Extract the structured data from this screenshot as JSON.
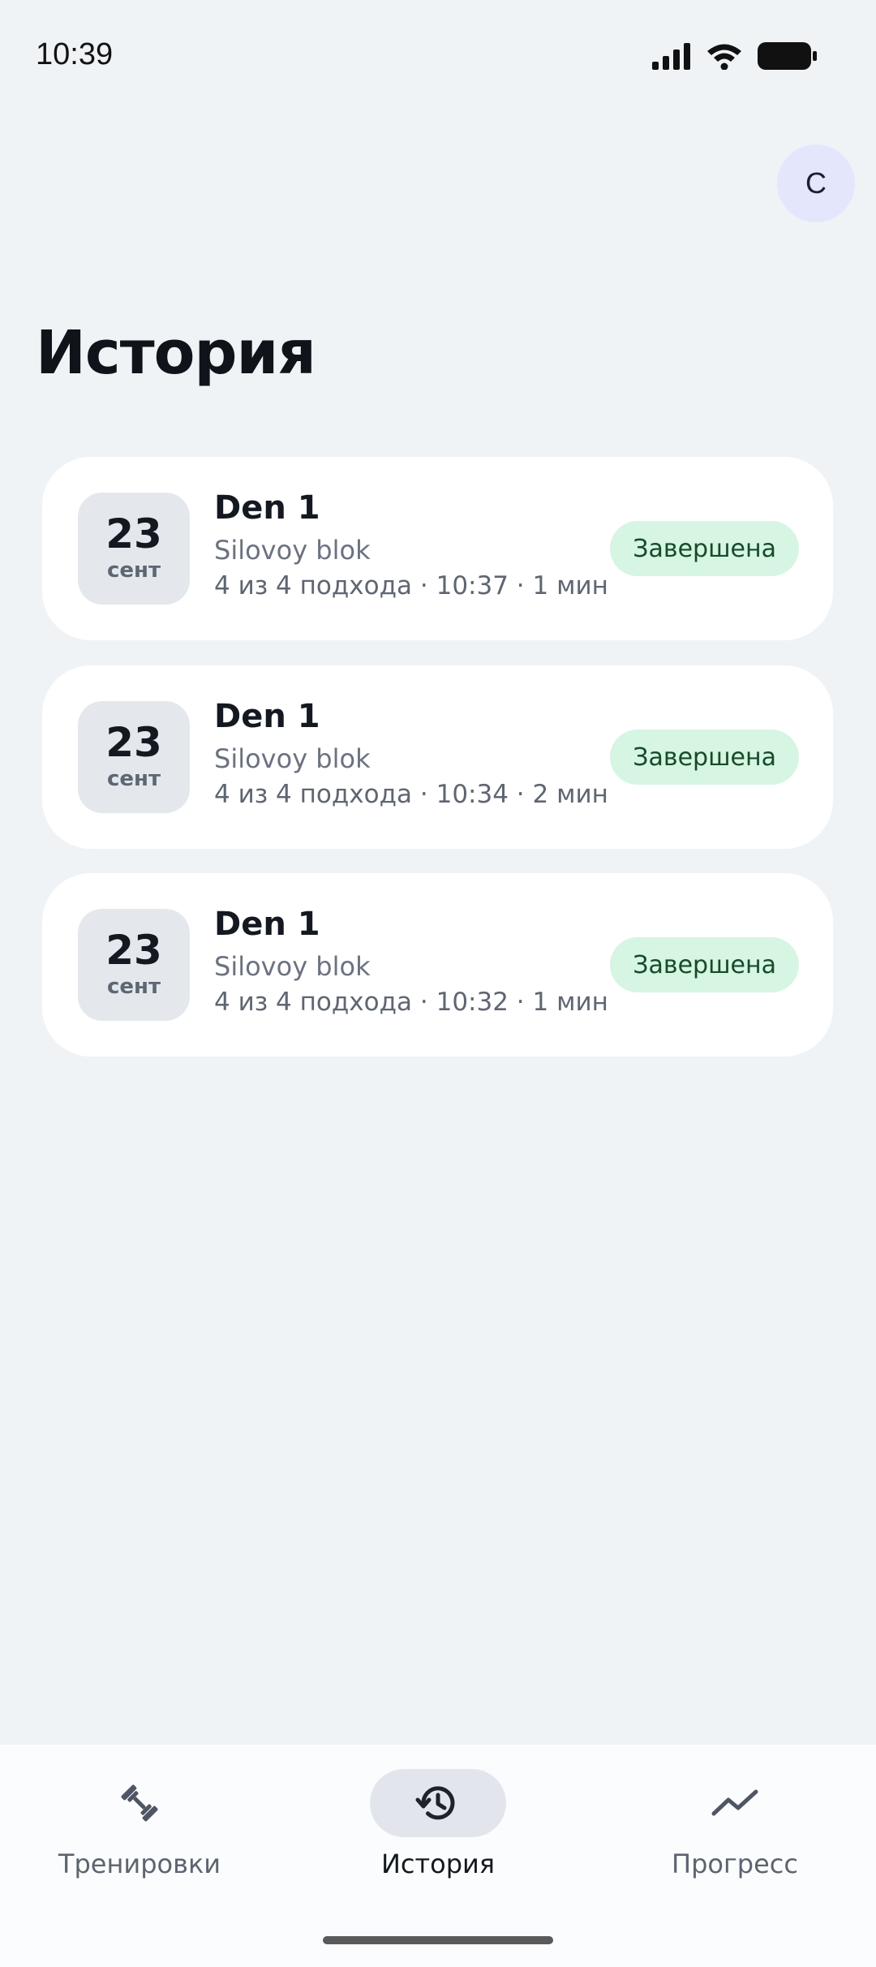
{
  "status_bar": {
    "time": "10:39"
  },
  "header": {
    "avatar_initial": "С",
    "title": "История"
  },
  "history": [
    {
      "day": "23",
      "month": "сент",
      "title": "Den 1",
      "subtitle": "Silovoy blok",
      "meta": "4 из 4 подхода · 10:37 · 1 мин",
      "status": "Завершена"
    },
    {
      "day": "23",
      "month": "сент",
      "title": "Den 1",
      "subtitle": "Silovoy blok",
      "meta": "4 из 4 подхода · 10:34 · 2 мин",
      "status": "Завершена"
    },
    {
      "day": "23",
      "month": "сент",
      "title": "Den 1",
      "subtitle": "Silovoy blok",
      "meta": "4 из 4 подхода · 10:32 · 1 мин",
      "status": "Завершена"
    }
  ],
  "nav": {
    "items": [
      {
        "label": "Тренировки",
        "icon": "dumbbell-icon",
        "active": false
      },
      {
        "label": "История",
        "icon": "history-icon",
        "active": true
      },
      {
        "label": "Прогресс",
        "icon": "trend-line-icon",
        "active": false
      }
    ]
  },
  "colors": {
    "status_pill_bg": "#d6f5e2",
    "status_pill_text": "#164b2b",
    "background": "#f0f3f5"
  }
}
